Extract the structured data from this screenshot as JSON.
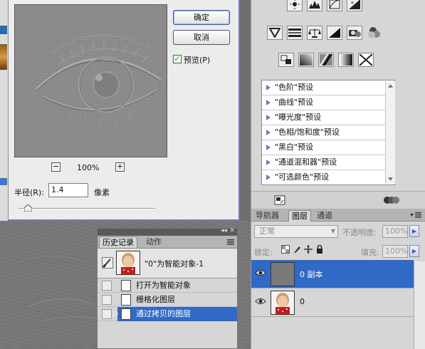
{
  "dialog": {
    "ok_label": "确定",
    "cancel_label": "取消",
    "preview_checked": true,
    "preview_label": "预览(P)",
    "zoom_out_symbol": "−",
    "zoom_in_symbol": "+",
    "zoom_value": "100%",
    "radius_label": "半径(R):",
    "radius_value": "1.4",
    "radius_unit": "像素"
  },
  "adjustments": {
    "icons_row1": [
      "brightness-contrast-icon",
      "levels-icon",
      "curves-icon",
      "exposure-icon"
    ],
    "icons_row2": [
      "vibrance-icon",
      "hue-saturation-icon",
      "color-balance-icon",
      "black-white-icon",
      "photo-filter-icon",
      "channel-mixer-icon"
    ],
    "icons_row3": [
      "invert-icon",
      "posterize-icon",
      "threshold-icon",
      "gradient-map-icon",
      "selective-color-icon"
    ],
    "presets": [
      "\"色阶\"预设",
      "\"曲线\"预设",
      "\"曝光度\"预设",
      "\"色相/饱和度\"预设",
      "\"黑白\"预设",
      "\"通道混和器\"预设",
      "\"可选颜色\"预设"
    ]
  },
  "layers": {
    "tabs": [
      "导航器",
      "图层",
      "通道"
    ],
    "active_tab": "图层",
    "blend_mode": "正常",
    "opacity_label": "不透明度:",
    "opacity_value": "100%",
    "lock_label": "锁定:",
    "fill_label": "填充:",
    "fill_value": "100%",
    "rows": [
      {
        "name": "0 副本",
        "selected": true
      },
      {
        "name": "0",
        "selected": false
      }
    ]
  },
  "history": {
    "tabs": [
      "历史记录",
      "动作"
    ],
    "active_tab": "历史记录",
    "snapshot_label": "\"0\"为智能对象-1",
    "items": [
      {
        "label": "打开为智能对象",
        "selected": false
      },
      {
        "label": "栅格化图层",
        "selected": false
      },
      {
        "label": "通过拷贝的图层",
        "selected": true
      }
    ]
  },
  "colors": {
    "selection_blue": "#3169c6",
    "panel_gray": "#d6d6d6",
    "dialog_bg": "#ececec"
  }
}
